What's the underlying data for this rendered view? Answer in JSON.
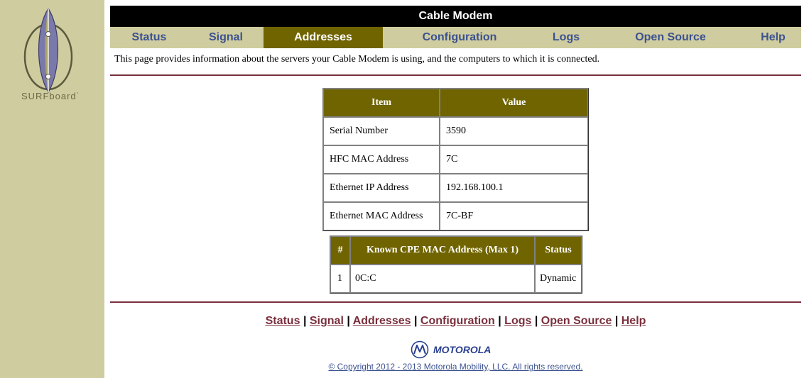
{
  "brand": {
    "logo_text": "SURFboard˙",
    "vendor": "MOTOROLA"
  },
  "title": "Cable Modem",
  "nav": {
    "tabs": [
      {
        "label": "Status",
        "active": false
      },
      {
        "label": "Signal",
        "active": false
      },
      {
        "label": "Addresses",
        "active": true
      },
      {
        "label": "Configuration",
        "active": false
      },
      {
        "label": "Logs",
        "active": false
      },
      {
        "label": "Open Source",
        "active": false
      },
      {
        "label": "Help",
        "active": false
      }
    ]
  },
  "intro": "This page provides information about the servers your Cable Modem is using, and the computers to which it is connected.",
  "info_table": {
    "headers": [
      "Item",
      "Value"
    ],
    "rows": [
      {
        "item": "Serial Number",
        "value": "3590"
      },
      {
        "item": "HFC MAC Address",
        "value": "7C"
      },
      {
        "item": "Ethernet IP Address",
        "value": "192.168.100.1"
      },
      {
        "item": "Ethernet MAC Address",
        "value": "7C-BF"
      }
    ]
  },
  "cpe_table": {
    "headers": [
      "#",
      "Known CPE MAC Address (Max 1)",
      "Status"
    ],
    "rows": [
      {
        "num": "1",
        "mac": "0C:C",
        "status": "Dynamic"
      }
    ]
  },
  "footer": {
    "links": [
      "Status",
      "Signal",
      "Addresses",
      "Configuration",
      "Logs",
      "Open Source",
      "Help"
    ],
    "separator": "|",
    "copyright": "© Copyright 2012 - 2013 Motorola Mobility, LLC. All rights reserved."
  },
  "colors": {
    "sidebar": "#cfcc9f",
    "accent_olive": "#706400",
    "nav_text": "#3c5290",
    "rule": "#7a2f3c",
    "title_bar": "#000000"
  }
}
